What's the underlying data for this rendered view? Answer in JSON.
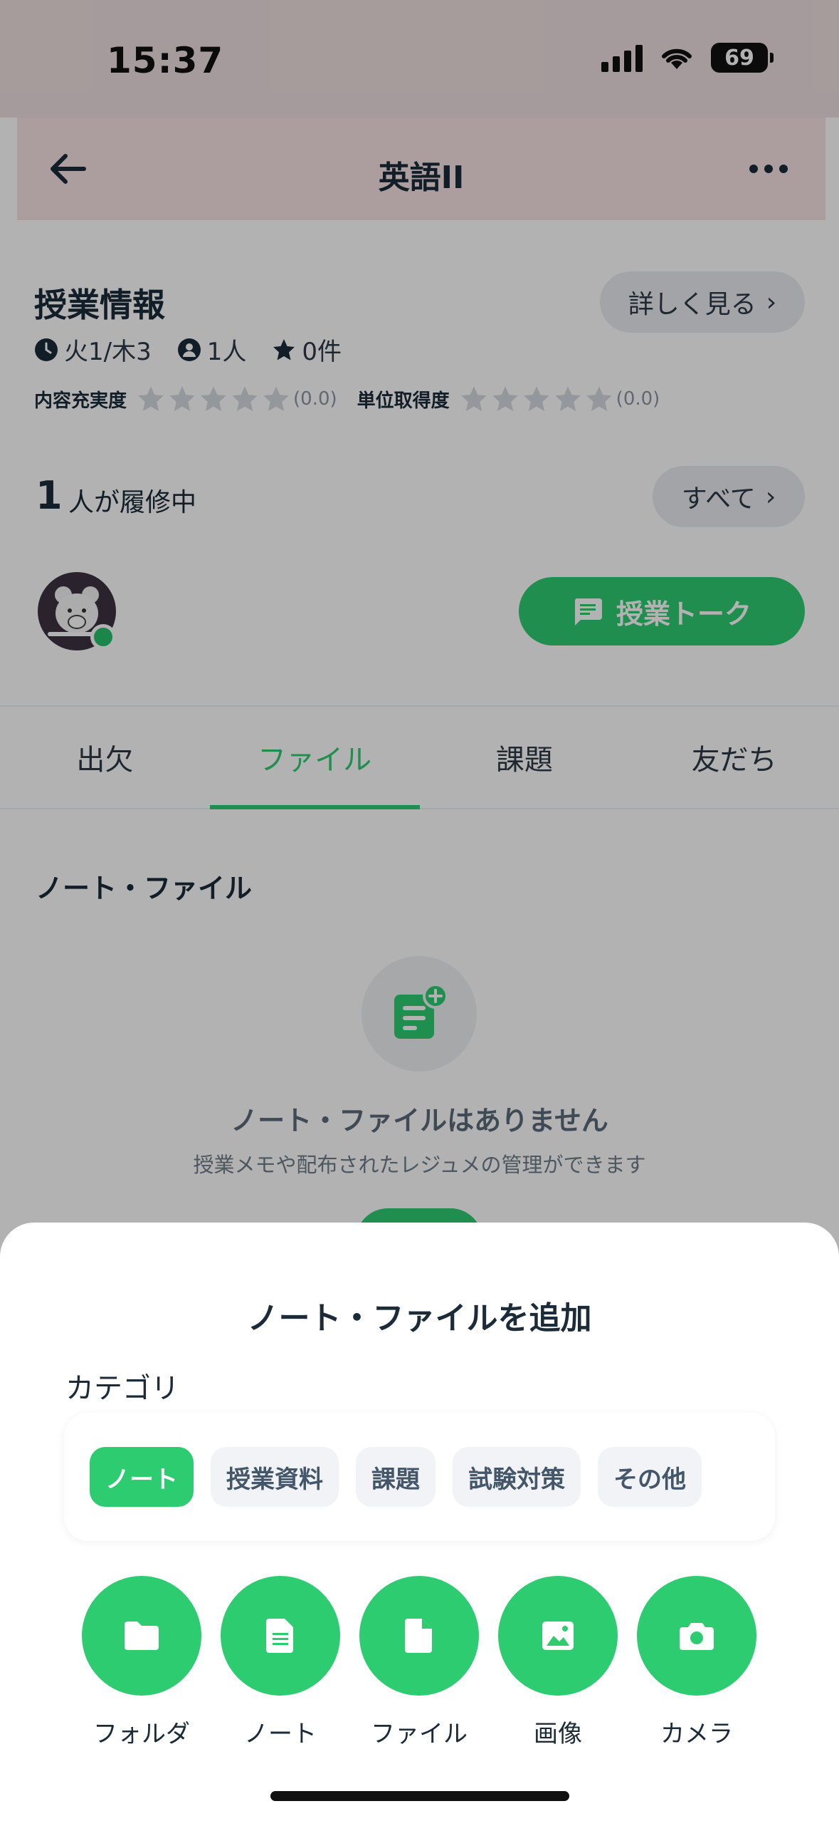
{
  "status_bar": {
    "time": "15:37",
    "battery": "69"
  },
  "nav": {
    "title": "英語II"
  },
  "course_info": {
    "title": "授業情報",
    "detail_button": "詳しく見る",
    "schedule": "火1/木3",
    "members": "1人",
    "reviews": "0件",
    "content_rating_label": "内容充実度",
    "content_rating_score": "(0.0)",
    "credit_rating_label": "単位取得度",
    "credit_rating_score": "(0.0)"
  },
  "enrollment": {
    "count": "1",
    "label": "人が履修中",
    "all_button": "すべて"
  },
  "talk_button": "授業トーク",
  "tabs": [
    {
      "label": "出欠"
    },
    {
      "label": "ファイル"
    },
    {
      "label": "課題"
    },
    {
      "label": "友だち"
    }
  ],
  "files": {
    "title": "ノート・ファイル",
    "empty_title": "ノート・ファイルはありません",
    "empty_subtitle": "授業メモや配布されたレジュメの管理ができます"
  },
  "sheet": {
    "title": "ノート・ファイルを追加",
    "category_label": "カテゴリ",
    "categories": [
      {
        "label": "ノート"
      },
      {
        "label": "授業資料"
      },
      {
        "label": "課題"
      },
      {
        "label": "試験対策"
      },
      {
        "label": "その他"
      }
    ],
    "actions": [
      {
        "label": "フォルダ",
        "icon": "folder-icon"
      },
      {
        "label": "ノート",
        "icon": "note-icon"
      },
      {
        "label": "ファイル",
        "icon": "file-icon"
      },
      {
        "label": "画像",
        "icon": "image-icon"
      },
      {
        "label": "カメラ",
        "icon": "camera-icon"
      }
    ]
  },
  "colors": {
    "accent": "#2ecc71",
    "nav_bg": "#f7e1e2",
    "text": "#1b2b38"
  }
}
